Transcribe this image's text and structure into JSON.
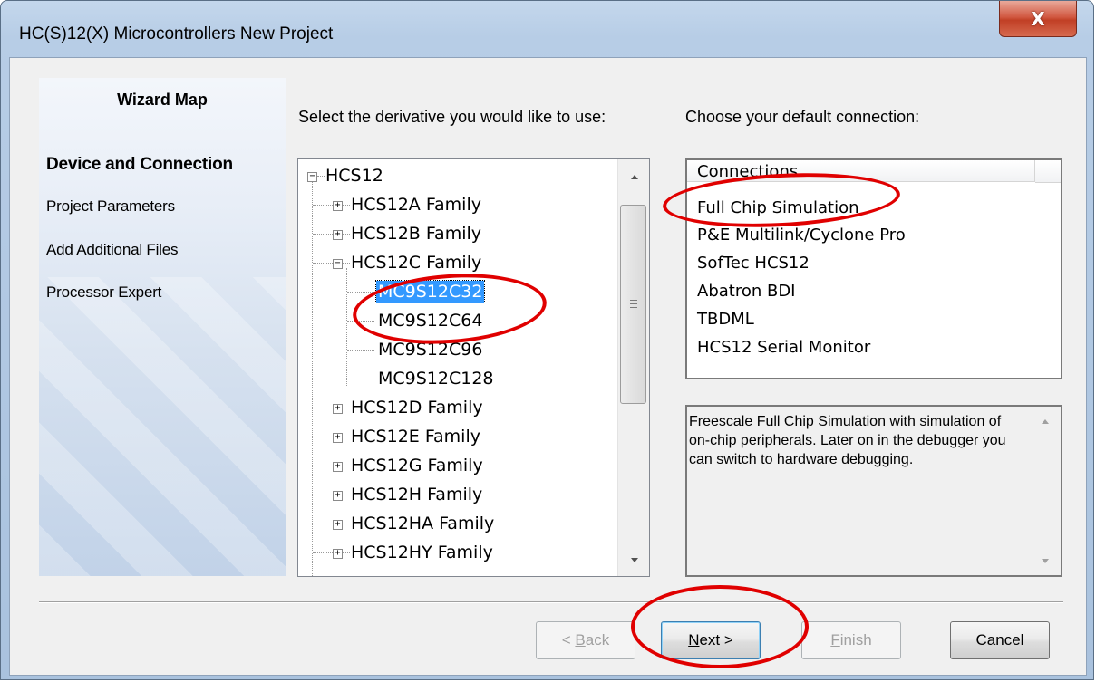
{
  "window": {
    "title": "HC(S)12(X) Microcontrollers New Project",
    "close_glyph": "X"
  },
  "wizard_map": {
    "title": "Wizard Map",
    "items": [
      {
        "label": "Device and Connection",
        "active": true
      },
      {
        "label": "Project Parameters",
        "active": false
      },
      {
        "label": "Add Additional Files",
        "active": false
      },
      {
        "label": "Processor Expert",
        "active": false
      }
    ]
  },
  "derivative": {
    "prompt": "Select the derivative you would like to use:",
    "tree": {
      "root": "HCS12",
      "families_before": [
        "HCS12A Family",
        "HCS12B Family"
      ],
      "expanded_family": "HCS12C Family",
      "expanded_children": [
        "MC9S12C32",
        "MC9S12C64",
        "MC9S12C96",
        "MC9S12C128"
      ],
      "selected": "MC9S12C32",
      "families_after": [
        "HCS12D Family",
        "HCS12E Family",
        "HCS12G Family",
        "HCS12H Family",
        "HCS12HA Family",
        "HCS12HY Family"
      ]
    }
  },
  "connection": {
    "prompt": "Choose your default connection:",
    "column_header": "Connections",
    "items": [
      "Full Chip Simulation",
      "P&E Multilink/Cyclone Pro",
      "SofTec HCS12",
      "Abatron BDI",
      "TBDML",
      "HCS12 Serial Monitor"
    ],
    "selected": "Full Chip Simulation",
    "description": "Freescale Full Chip Simulation with simulation of on-chip peripherals. Later on in the debugger you can switch to hardware debugging."
  },
  "buttons": {
    "back": {
      "prefix": "< ",
      "mnemonic": "B",
      "rest": "ack",
      "enabled": false
    },
    "next": {
      "mnemonic": "N",
      "rest": "ext >",
      "enabled": true
    },
    "finish": {
      "mnemonic": "F",
      "rest": "inish",
      "enabled": false
    },
    "cancel": {
      "label": "Cancel",
      "enabled": true
    }
  },
  "annotation_color": "#e00000",
  "selection_color": "#3399ff"
}
